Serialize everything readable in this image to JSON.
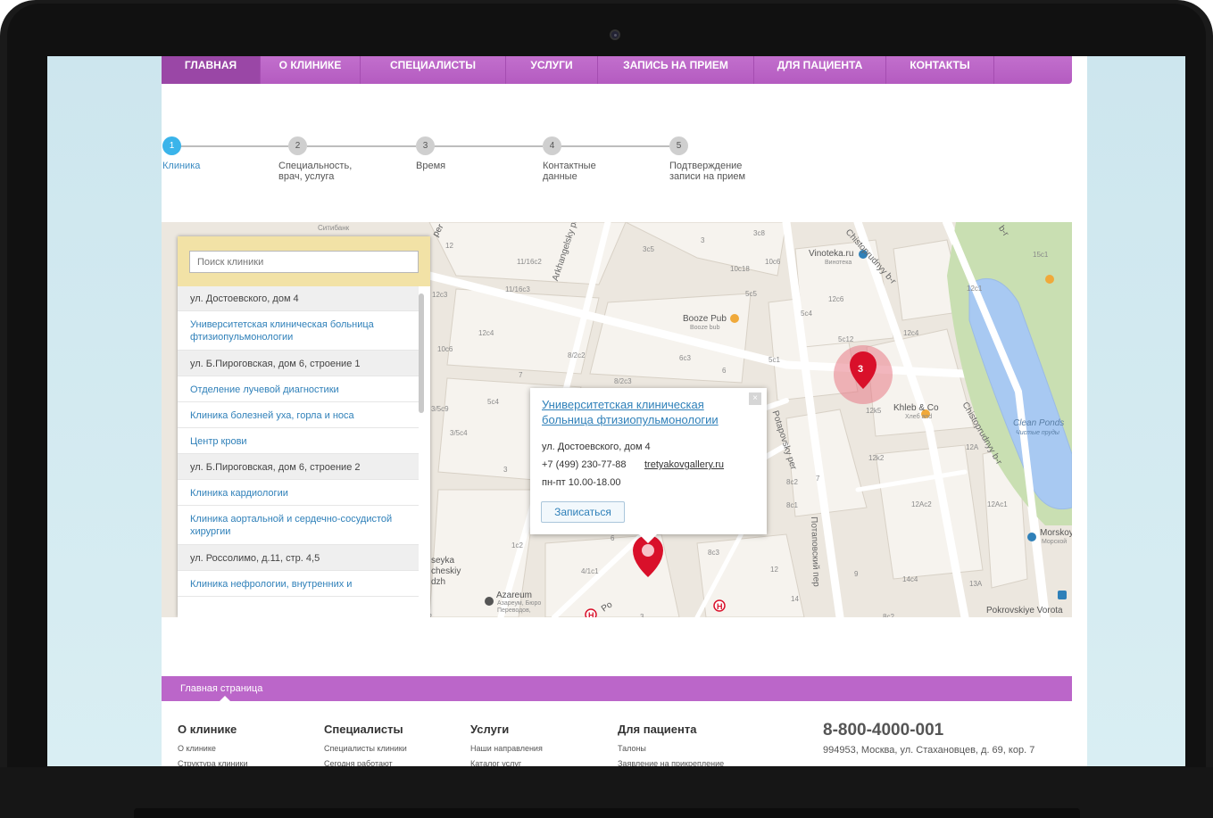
{
  "nav": {
    "items": [
      {
        "label": "Главная",
        "active": true
      },
      {
        "label": "О клинике"
      },
      {
        "label": "Специалисты"
      },
      {
        "label": "Услуги"
      },
      {
        "label": "Запись на прием"
      },
      {
        "label": "Для пациента"
      },
      {
        "label": "Контакты"
      }
    ]
  },
  "steps": [
    {
      "number": "1",
      "label": "Клиника",
      "active": true
    },
    {
      "number": "2",
      "label": "Специальность, врач, услуга"
    },
    {
      "number": "3",
      "label": "Время"
    },
    {
      "number": "4",
      "label": "Контактные данные"
    },
    {
      "number": "5",
      "label": "Подтверждение записи на прием"
    }
  ],
  "clinic_panel": {
    "search_placeholder": "Поиск клиники",
    "rows": [
      {
        "type": "addr",
        "text": "ул. Достоевского, дом 4"
      },
      {
        "type": "clinic",
        "text": "Университетская клиническая больница фтизиопульмонологии"
      },
      {
        "type": "addr",
        "text": "ул. Б.Пироговская, дом 6, строение 1"
      },
      {
        "type": "clinic",
        "text": "Отделение лучевой диагностики"
      },
      {
        "type": "clinic",
        "text": "Клиника болезней уха, горла и носа"
      },
      {
        "type": "clinic",
        "text": "Центр крови"
      },
      {
        "type": "addr",
        "text": "ул. Б.Пироговская, дом 6, строение 2"
      },
      {
        "type": "clinic",
        "text": "Клиника кардиологии"
      },
      {
        "type": "clinic",
        "text": "Клиника аортальной и сердечно-сосудистой хирургии"
      },
      {
        "type": "addr",
        "text": "ул. Россолимо, д.11, стр. 4,5"
      },
      {
        "type": "clinic",
        "text": "Клиника нефрологии, внутренних и"
      }
    ]
  },
  "popup": {
    "title": "Университетская клиническая больница фтизиопульмонологии",
    "address": "ул. Достоевского, дом 4",
    "phone": "+7 (499) 230-77-88",
    "website": "tretyakovgallery.ru",
    "hours": "пн-пт 10.00-18.00",
    "button": "Записаться",
    "close": "×"
  },
  "map": {
    "cluster_count": "3",
    "labels": {
      "citibank": "Ситибанк",
      "arkhangelsky": "Arkhangelsky per",
      "potapovsky_en": "Potapovsky per",
      "potapovsky_ru": "Потаповский пер",
      "chistoprudny_top": "Chistoprudnyy b-r",
      "chistoprudny_side": "Chistoprudnyy b-r",
      "vinoteka": "Vinoteka.ru",
      "vinoteka_ru": "Винотека",
      "booze_pub": "Booze Pub",
      "booze_bub": "Booze bub",
      "khleb": "Khleb & Co",
      "khleb_ru": "Хлеб and",
      "clean_ponds": "Clean Ponds",
      "clean_ponds_ru": "Чистые пруды",
      "morskoy": "Morskoy",
      "morskoy_ru": "Морской",
      "pokrovskiye": "Pokrovskiye Vorota",
      "azareum": "Azareum",
      "azareum_ru": "Азареум, Бюро Переводов,",
      "seyka": "seyka",
      "cheskiy": "cheskiy",
      "dzh": "dzh",
      "h_letter": "H",
      "per_tl": "per",
      "per_bottom": "Po",
      "b_r_tr": "b-r"
    },
    "house_numbers": [
      "12",
      "11/16c2",
      "11/16c3",
      "12c3",
      "12c4",
      "10c6",
      "8/2c2",
      "8/2c3",
      "7",
      "6",
      "5c4",
      "3/5c9",
      "3/5c4",
      "3",
      "3c5",
      "3c8",
      "10c18",
      "10c6",
      "5c5",
      "5c4",
      "6c3",
      "5c1",
      "12c6",
      "12c4",
      "5c12",
      "12c1",
      "15c1",
      "12k5",
      "12k2",
      "12A",
      "12Ac2",
      "12Ac1",
      "8c2",
      "8c1",
      "7",
      "6",
      "1c2",
      "8c3",
      "4/1c1",
      "12",
      "9",
      "14c4",
      "13A",
      "14",
      "8c2",
      "3",
      "4c2",
      "3"
    ]
  },
  "footer": {
    "bar_label": "Главная страница",
    "columns": [
      {
        "title": "О клинике",
        "links": [
          "О клинике",
          "Структура клиники"
        ]
      },
      {
        "title": "Специалисты",
        "links": [
          "Специалисты клиники",
          "Сегодня работают"
        ]
      },
      {
        "title": "Услуги",
        "links": [
          "Наши направления",
          "Каталог услуг"
        ]
      },
      {
        "title": "Для пациента",
        "links": [
          "Талоны",
          "Заявление на прикрепление"
        ]
      }
    ],
    "phone": "8-800-4000-001",
    "address": "994953, Москва, ул. Стахановцев, д. 69, кор. 7"
  },
  "colors": {
    "nav_purple": "#b45bc0",
    "link_blue": "#2f80b9",
    "step_active": "#3ab4ea",
    "marker_red": "#d9102a"
  }
}
